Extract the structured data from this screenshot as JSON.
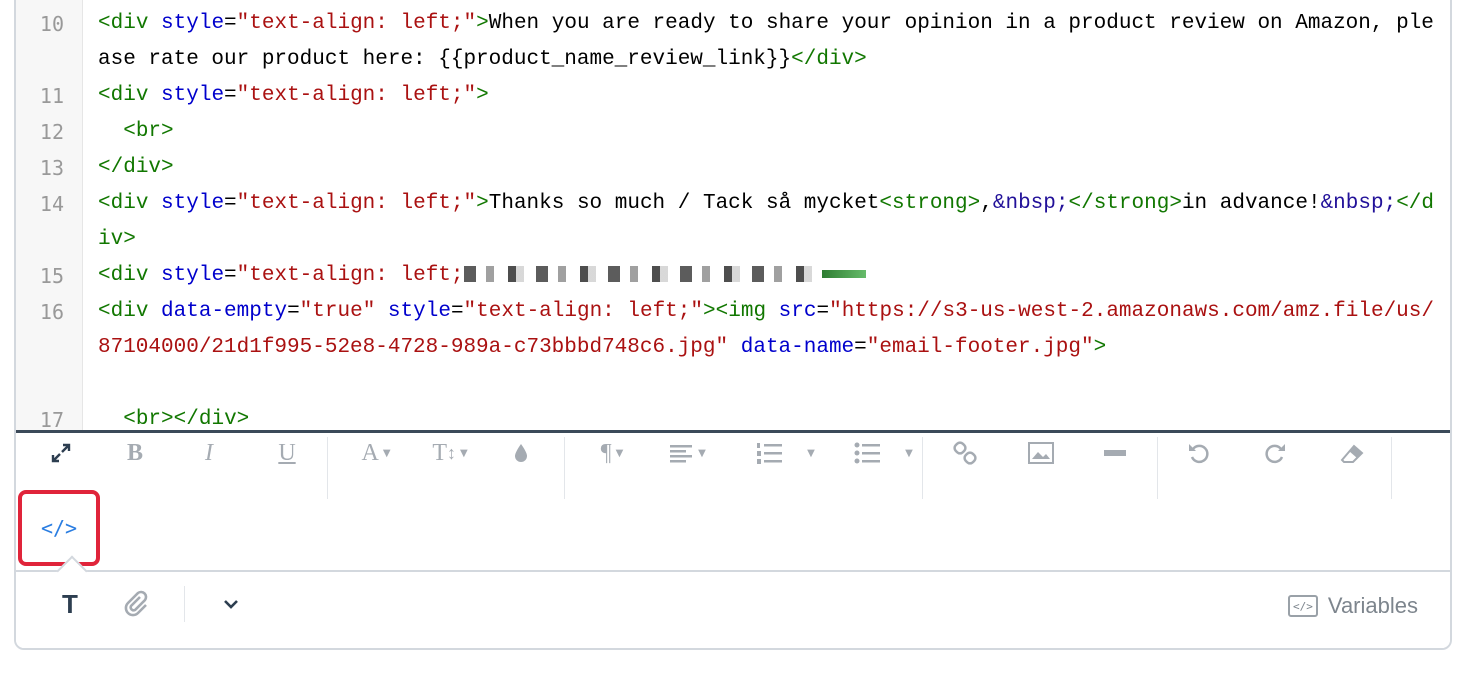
{
  "code": {
    "line_numbers": [
      "10",
      "11",
      "12",
      "13",
      "14",
      "15",
      "16",
      "17"
    ],
    "line10_text": "When you are ready to share your opinion in a product review on Amazon, please rate our product here: {{product_name_review_link}}",
    "line14_text_a": "Thanks so much / Tack så mycket",
    "line14_text_b": "in advance!",
    "tag_div": "div",
    "tag_br": "br",
    "tag_strong": "strong",
    "tag_img": "img",
    "attr_style": "style",
    "attr_data_empty": "data-empty",
    "attr_src": "src",
    "attr_data_name": "data-name",
    "val_text_align": "text-align: left;",
    "val_true": "true",
    "val_src": "https://s3-us-west-2.amazonaws.com/amz.file/us/87104000/21d1f995-52e8-4728-989a-c73bbbd748c6.jpg",
    "val_data_name": "email-footer.jpg",
    "entity_nbsp": "&nbsp;",
    "comma": ","
  },
  "toolbar": {
    "icons": {
      "fullscreen": "fullscreen-expand-icon",
      "bold": "bold-icon",
      "italic": "italic-icon",
      "underline": "underline-icon",
      "font": "font-icon",
      "font_size": "font-size-icon",
      "color": "text-color-icon",
      "paragraph": "paragraph-icon",
      "align": "align-icon",
      "ordered_list": "ordered-list-icon",
      "unordered_list": "unordered-list-icon",
      "link": "link-icon",
      "image": "image-icon",
      "hr": "horizontal-rule-icon",
      "undo": "undo-icon",
      "redo": "redo-icon",
      "eraser": "clear-format-icon",
      "code_view": "code-view-icon"
    },
    "bold_label": "B",
    "italic_label": "I",
    "underline_label": "U",
    "font_label": "A",
    "font_size_label": "T",
    "paragraph_label": "¶",
    "code_view_label": "</>"
  },
  "bottom_bar": {
    "text_format_label": "T",
    "variables_label": "Variables"
  },
  "colors": {
    "tag": "#117700",
    "attr": "#0000cc",
    "string": "#aa1111",
    "entity": "#221199",
    "highlight": "#e0243a",
    "code_toggle": "#2a7de1"
  }
}
